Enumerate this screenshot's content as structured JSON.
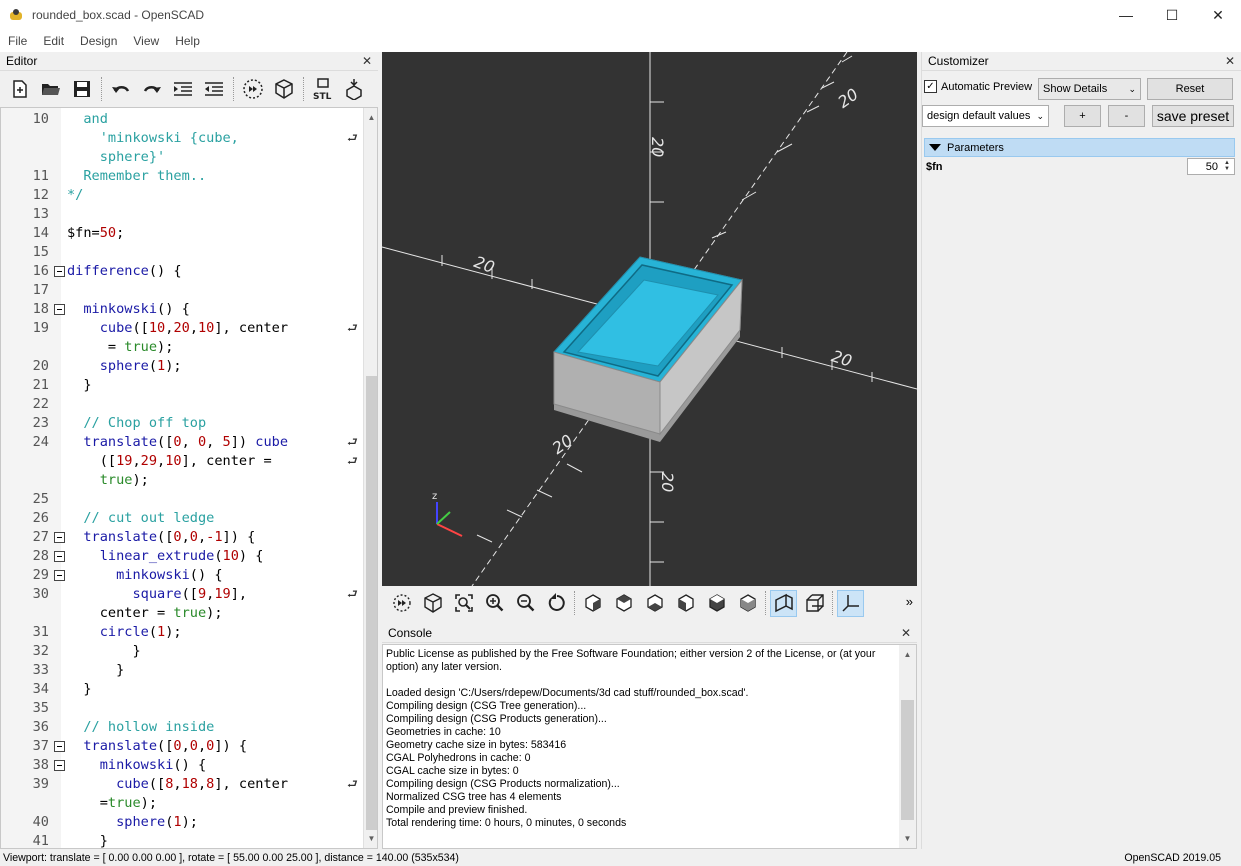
{
  "window": {
    "title": "rounded_box.scad - OpenSCAD",
    "minimize": "—",
    "maximize": "☐",
    "close": "✕"
  },
  "menu": [
    "File",
    "Edit",
    "Design",
    "View",
    "Help"
  ],
  "editor": {
    "title": "Editor",
    "close": "✕",
    "toolbar_icons": [
      "new-file-icon",
      "open-file-icon",
      "save-icon",
      "undo-icon",
      "redo-icon",
      "indent-icon",
      "unindent-icon",
      "preview-icon",
      "render-icon",
      "export-stl-icon",
      "send-to-printer-icon"
    ],
    "stl_label": "STL",
    "lines": [
      {
        "num": "10",
        "text": "  and"
      },
      {
        "num": "",
        "text": "    'minkowski {cube,"
      },
      {
        "num": "",
        "text": "    sphere}'"
      },
      {
        "num": "11",
        "text": "  Remember them.."
      },
      {
        "num": "12",
        "text": "*/"
      },
      {
        "num": "13",
        "text": ""
      },
      {
        "num": "14",
        "text": "$fn=50;"
      },
      {
        "num": "15",
        "text": ""
      },
      {
        "num": "16",
        "text": "difference() {"
      },
      {
        "num": "17",
        "text": ""
      },
      {
        "num": "18",
        "text": "  minkowski() {"
      },
      {
        "num": "19",
        "text": "    cube([10,20,10], center"
      },
      {
        "num": "",
        "text": "     = true);"
      },
      {
        "num": "20",
        "text": "    sphere(1);"
      },
      {
        "num": "21",
        "text": "  }"
      },
      {
        "num": "22",
        "text": ""
      },
      {
        "num": "23",
        "text": "  // Chop off top"
      },
      {
        "num": "24",
        "text": "  translate([0, 0, 5]) cube"
      },
      {
        "num": "",
        "text": "    ([19,29,10], center ="
      },
      {
        "num": "",
        "text": "    true);"
      },
      {
        "num": "25",
        "text": ""
      },
      {
        "num": "26",
        "text": "  // cut out ledge"
      },
      {
        "num": "27",
        "text": "  translate([0,0,-1]) {"
      },
      {
        "num": "28",
        "text": "    linear_extrude(10) {"
      },
      {
        "num": "29",
        "text": "      minkowski() {"
      },
      {
        "num": "30",
        "text": "        square([9,19],"
      },
      {
        "num": "",
        "text": "    center = true);"
      },
      {
        "num": "31",
        "text": "    circle(1);"
      },
      {
        "num": "32",
        "text": "        }"
      },
      {
        "num": "33",
        "text": "      }"
      },
      {
        "num": "34",
        "text": "  }"
      },
      {
        "num": "35",
        "text": ""
      },
      {
        "num": "36",
        "text": "  // hollow inside"
      },
      {
        "num": "37",
        "text": "  translate([0,0,0]) {"
      },
      {
        "num": "38",
        "text": "    minkowski() {"
      },
      {
        "num": "39",
        "text": "      cube([8,18,8], center"
      },
      {
        "num": "",
        "text": "    =true);"
      },
      {
        "num": "40",
        "text": "      sphere(1);"
      },
      {
        "num": "41",
        "text": "    }"
      }
    ]
  },
  "viewport": {
    "axis_labels": [
      "20",
      "20",
      "20",
      "20",
      "20",
      "20"
    ],
    "small_axis": "z",
    "model_top_color": "#27b3d6",
    "model_side_color": "#b8b8b8",
    "background": "#333333"
  },
  "view_toolbar": {
    "icons": [
      "preview-icon",
      "render-icon",
      "view-all-icon",
      "zoom-in-icon",
      "zoom-out-icon",
      "reset-view-icon",
      "view-right-icon",
      "view-top-icon",
      "view-bottom-icon",
      "view-left-icon",
      "view-front-icon",
      "view-back-icon",
      "perspective-icon",
      "orthogonal-icon",
      "show-axes-icon"
    ],
    "more": "»"
  },
  "console": {
    "title": "Console",
    "close": "✕",
    "lines": [
      "Public License as published by the Free Software Foundation; either version 2 of the License, or (at your",
      "option) any later version.",
      "",
      "Loaded design 'C:/Users/rdepew/Documents/3d cad stuff/rounded_box.scad'.",
      "Compiling design (CSG Tree generation)...",
      "Compiling design (CSG Products generation)...",
      "Geometries in cache: 10",
      "Geometry cache size in bytes: 583416",
      "CGAL Polyhedrons in cache: 0",
      "CGAL cache size in bytes: 0",
      "Compiling design (CSG Products normalization)...",
      "Normalized CSG tree has 4 elements",
      "Compile and preview finished.",
      "Total rendering time: 0 hours, 0 minutes, 0 seconds"
    ]
  },
  "customizer": {
    "title": "Customizer",
    "close": "✕",
    "auto_preview_checked": "✓",
    "auto_preview_label": "Automatic Preview",
    "details_select": "Show Details",
    "reset_button": "Reset",
    "preset_select": "design default values",
    "plus_button": "+",
    "minus_button": "-",
    "save_preset_button": "save preset",
    "parameters_header": "Parameters",
    "param_name": "$fn",
    "param_value": "50"
  },
  "status": {
    "viewport_info": "Viewport: translate = [ 0.00 0.00 0.00 ], rotate = [ 55.00 0.00 25.00 ], distance = 140.00 (535x534)",
    "version": "OpenSCAD 2019.05"
  }
}
